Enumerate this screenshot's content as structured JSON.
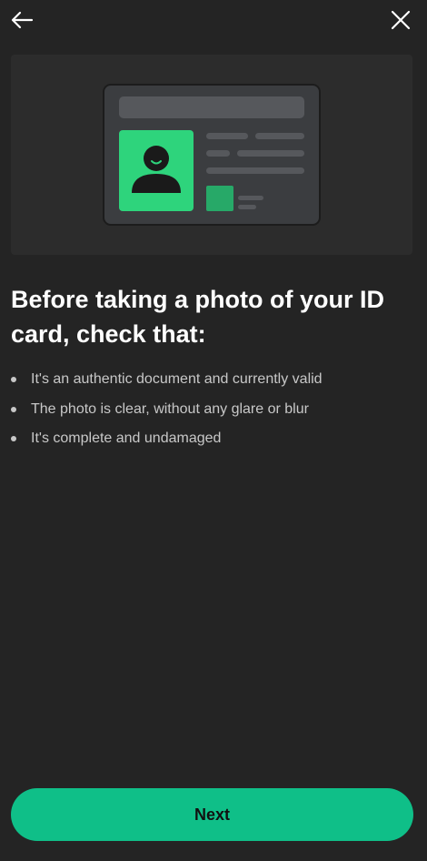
{
  "header": {
    "back_icon": "arrow-left-icon",
    "close_icon": "close-icon"
  },
  "illustration": {
    "name": "id-card-illustration",
    "accent_color": "#2ed47c",
    "card_color": "#3b3d40"
  },
  "title": "Before taking a photo of your ID card, check that:",
  "checklist": [
    "It's an authentic document and currently valid",
    "The photo is clear, without any glare or blur",
    "It's complete and undamaged"
  ],
  "next_button": {
    "label": "Next",
    "color": "#0fbf88"
  }
}
